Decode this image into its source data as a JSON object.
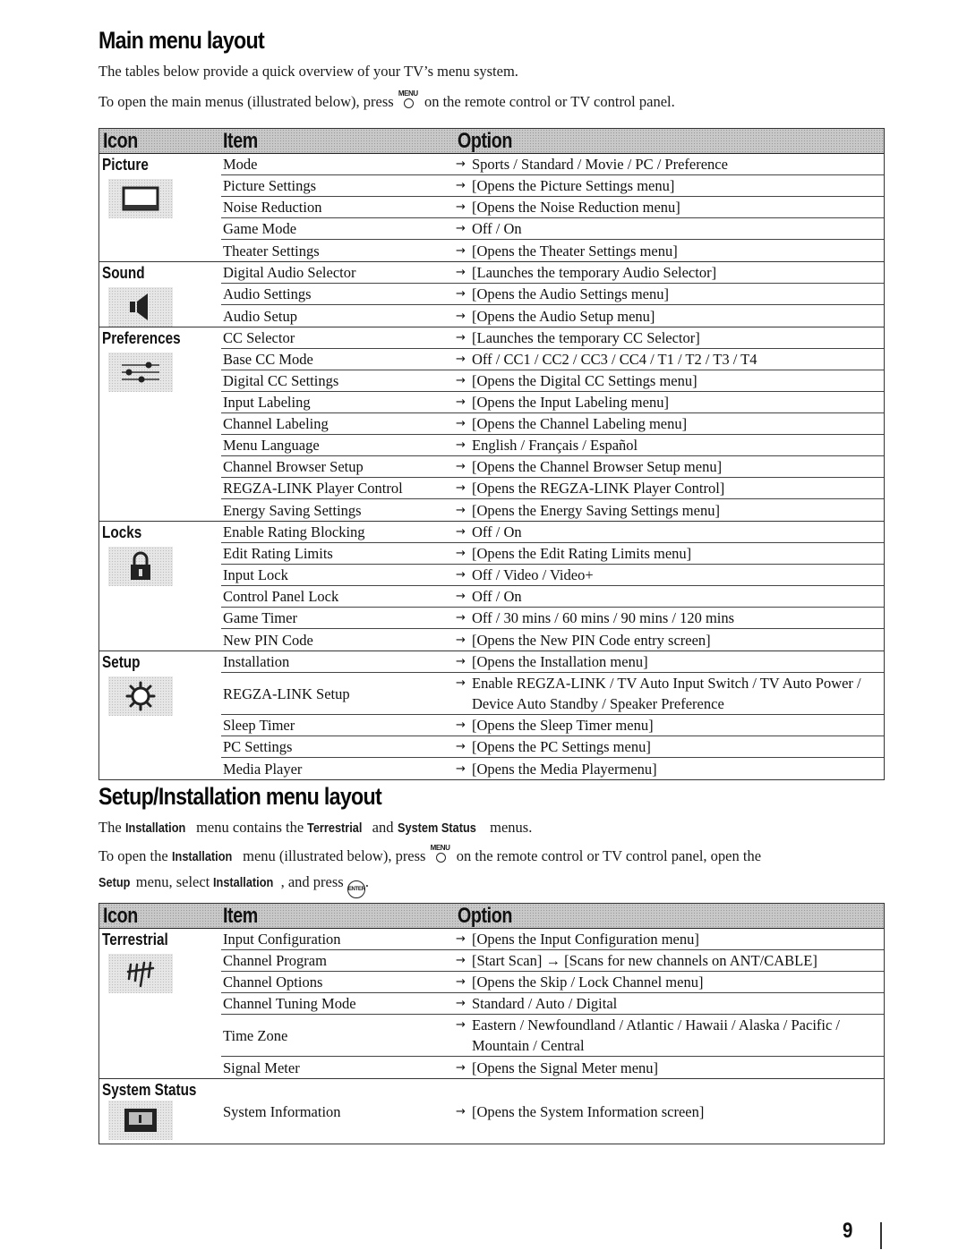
{
  "main_section": {
    "title": "Main menu layout",
    "intro": "The tables below provide a quick overview of your TV’s menu system.",
    "open_prefix": "To open the main menus (illustrated below), press",
    "menu_key_label": "MENU",
    "open_suffix": "on the remote control or TV control panel."
  },
  "main_table": {
    "headers": {
      "icon": "Icon",
      "item": "Item",
      "option": "Option"
    },
    "arrow_glyph": "→",
    "groups": [
      {
        "label": "Picture",
        "icon": "picture-icon",
        "rows": [
          {
            "item": "Mode",
            "option": "Sports / Standard / Movie / PC / Preference"
          },
          {
            "item": "Picture Settings",
            "option": "[Opens the Picture Settings menu]"
          },
          {
            "item": "Noise Reduction",
            "option": "[Opens the Noise Reduction menu]"
          },
          {
            "item": "Game Mode",
            "option": "Off / On"
          },
          {
            "item": "Theater Settings",
            "option": "[Opens the Theater Settings menu]"
          }
        ]
      },
      {
        "label": "Sound",
        "icon": "speaker-icon",
        "rows": [
          {
            "item": "Digital Audio Selector",
            "option": "[Launches the temporary Audio Selector]"
          },
          {
            "item": "Audio Settings",
            "option": "[Opens the Audio Settings menu]"
          },
          {
            "item": "Audio Setup",
            "option": "[Opens the Audio Setup menu]"
          }
        ]
      },
      {
        "label": "Preferences",
        "icon": "sliders-icon",
        "rows": [
          {
            "item": "CC Selector",
            "option": "[Launches the temporary CC Selector]"
          },
          {
            "item": "Base CC Mode",
            "option": "Off / CC1 / CC2 / CC3 / CC4 / T1 / T2 / T3 / T4"
          },
          {
            "item": "Digital CC Settings",
            "option": "[Opens the Digital CC Settings menu]"
          },
          {
            "item": "Input Labeling",
            "option": "[Opens the Input Labeling menu]"
          },
          {
            "item": "Channel Labeling",
            "option": "[Opens the Channel Labeling menu]"
          },
          {
            "item": "Menu Language",
            "option": "English / Français / Español"
          },
          {
            "item": "Channel Browser Setup",
            "option": "[Opens the Channel Browser Setup menu]"
          },
          {
            "item": "REGZA-LINK Player Control",
            "option": "[Opens the REGZA-LINK Player Control]"
          },
          {
            "item": "Energy Saving Settings",
            "option": "[Opens the Energy Saving Settings menu]"
          }
        ]
      },
      {
        "label": "Locks",
        "icon": "lock-icon",
        "rows": [
          {
            "item": "Enable Rating Blocking",
            "option": "Off / On"
          },
          {
            "item": "Edit Rating Limits",
            "option": "[Opens the Edit Rating Limits menu]"
          },
          {
            "item": "Input Lock",
            "option": "Off / Video / Video+"
          },
          {
            "item": "Control Panel Lock",
            "option": "Off / On"
          },
          {
            "item": "Game Timer",
            "option": "Off / 30 mins / 60 mins / 90 mins / 120 mins"
          },
          {
            "item": "New PIN Code",
            "option": "[Opens the New PIN Code entry screen]"
          }
        ]
      },
      {
        "label": "Setup",
        "icon": "gear-icon",
        "rows": [
          {
            "item": "Installation",
            "option": "[Opens the Installation menu]"
          },
          {
            "item": "REGZA-LINK Setup",
            "option": "Enable REGZA-LINK / TV Auto Input Switch / TV Auto Power / Device Auto Standby / Speaker Preference"
          },
          {
            "item": "Sleep Timer",
            "option": "[Opens the Sleep Timer menu]"
          },
          {
            "item": "PC Settings",
            "option": "[Opens the PC Settings menu]"
          },
          {
            "item": "Media Player",
            "option": "[Opens the Media Playermenu]"
          }
        ]
      }
    ]
  },
  "setup_section": {
    "title": "Setup/Installation menu layout",
    "line1": {
      "p1": "The",
      "b1": "Installation",
      "p2": "menu contains the",
      "b2": "Terrestrial",
      "p3": "and",
      "b3": "System Status",
      "p4": "menus."
    },
    "line2": {
      "p1": "To open the",
      "b1": "Installation",
      "p2": "menu (illustrated below), press",
      "key": "MENU",
      "p3": "on the remote control or TV control panel, open the"
    },
    "line3": {
      "b1": "Setup",
      "p1": "menu, select",
      "b2": "Installation",
      "p2": ", and press",
      "enter_key": "ENTER",
      "p3": "."
    }
  },
  "setup_table": {
    "headers": {
      "icon": "Icon",
      "item": "Item",
      "option": "Option"
    },
    "groups": [
      {
        "label": "Terrestrial",
        "icon": "antenna-icon",
        "rows": [
          {
            "item": "Input Configuration",
            "option": "[Opens the Input Configuration menu]"
          },
          {
            "item": "Channel Program",
            "option": "[Start Scan] → [Scans for new channels on ANT/CABLE]"
          },
          {
            "item": "Channel Options",
            "option": "[Opens the Skip / Lock Channel menu]"
          },
          {
            "item": "Channel Tuning Mode",
            "option": "Standard / Auto / Digital"
          },
          {
            "item": "Time Zone",
            "option": "Eastern / Newfoundland / Atlantic / Hawaii / Alaska / Pacific / Mountain / Central"
          },
          {
            "item": "Signal Meter",
            "option": "[Opens the Signal Meter menu]"
          }
        ]
      },
      {
        "label": "System Status",
        "icon": "info-screen-icon",
        "rows": [
          {
            "item": "System Information",
            "option": "[Opens the System Information screen]"
          }
        ]
      }
    ]
  },
  "footer": {
    "page_number": "9"
  }
}
